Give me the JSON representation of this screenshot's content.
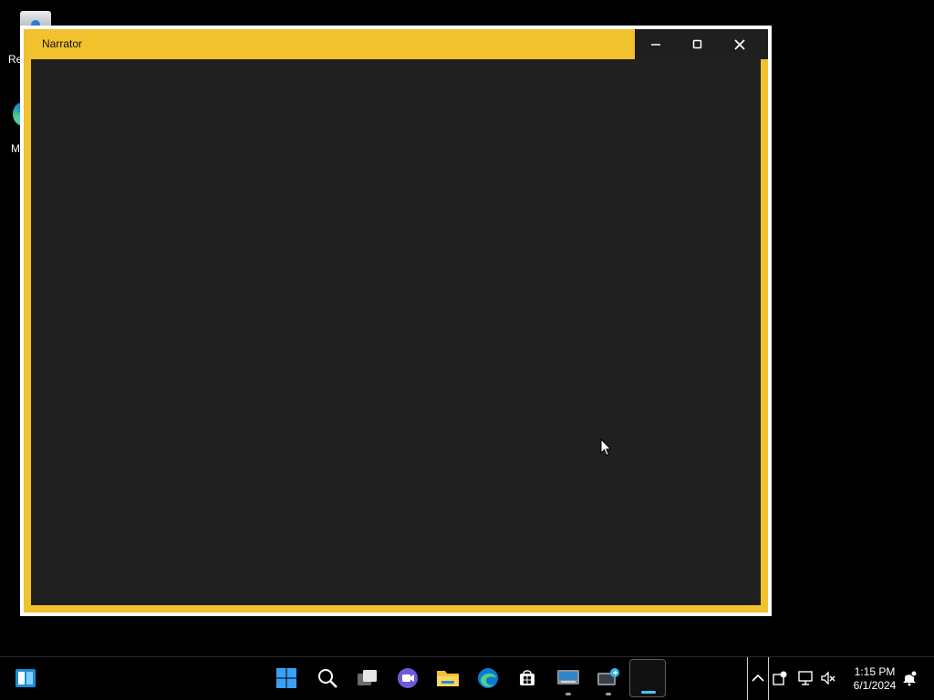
{
  "desktop": {
    "icons": [
      {
        "label": "Re",
        "icon": "recycle-bin-icon"
      },
      {
        "label": "M",
        "icon": "edge-icon"
      }
    ]
  },
  "window": {
    "title": "Narrator",
    "controls": {
      "minimize": "minimize-icon",
      "maximize": "maximize-icon",
      "close": "close-icon"
    },
    "colors": {
      "frame": "#f2c12e",
      "client": "#202020",
      "outer_border": "#ffffff"
    }
  },
  "taskbar": {
    "items": [
      {
        "icon": "windows-logo-icon"
      },
      {
        "icon": "start-icon"
      },
      {
        "icon": "search-icon"
      },
      {
        "icon": "task-view-icon"
      },
      {
        "icon": "teams-chat-icon"
      },
      {
        "icon": "file-explorer-icon"
      },
      {
        "icon": "edge-icon"
      },
      {
        "icon": "store-icon"
      },
      {
        "icon": "on-screen-keyboard-icon"
      },
      {
        "icon": "remote-desktop-icon"
      },
      {
        "icon": "narrator-icon"
      }
    ],
    "tray": {
      "icons": [
        "chevron-up-icon",
        "security-icon",
        "network-icon",
        "volume-muted-icon",
        "notification-icon"
      ],
      "time": "1:15 PM",
      "date": "6/1/2024"
    }
  }
}
